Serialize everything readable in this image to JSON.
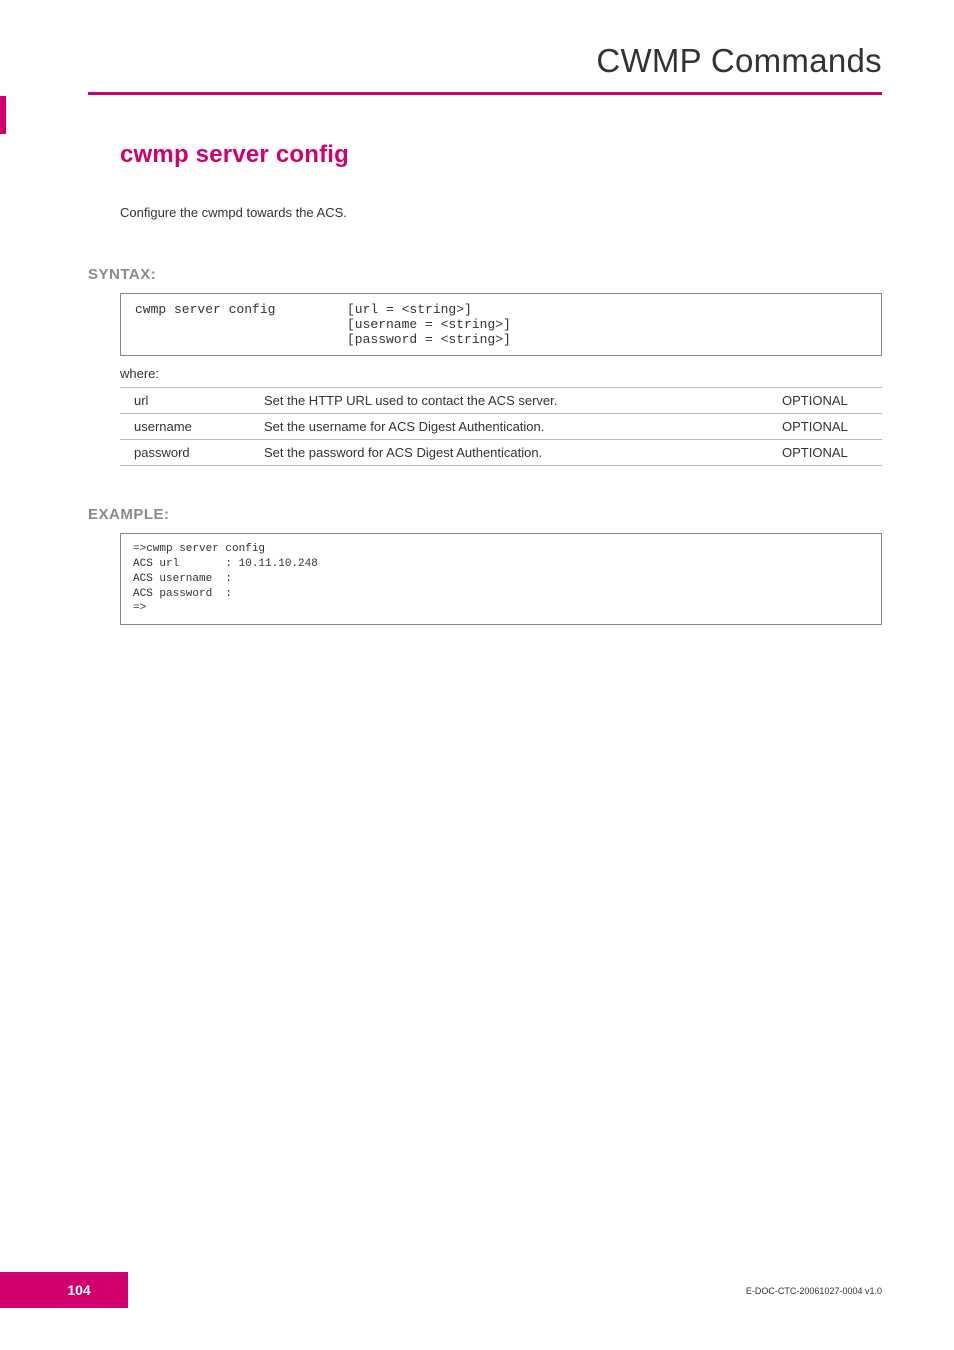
{
  "header": {
    "title": "CWMP Commands"
  },
  "sidetab": true,
  "cmd": {
    "title": "cwmp server config",
    "intro": "Configure the cwmpd towards the ACS."
  },
  "syntax": {
    "label": "SYNTAX:",
    "command": "cwmp server config",
    "args": "[url = <string>]\n[username = <string>]\n[password = <string>]",
    "where": "where:",
    "params": [
      {
        "name": "url",
        "desc": "Set the HTTP URL used to contact the ACS server.",
        "opt": "OPTIONAL"
      },
      {
        "name": "username",
        "desc": "Set the username for ACS Digest Authentication.",
        "opt": "OPTIONAL"
      },
      {
        "name": "password",
        "desc": "Set the password for ACS Digest Authentication.",
        "opt": "OPTIONAL"
      }
    ]
  },
  "example": {
    "label": "EXAMPLE:",
    "text": "=>cwmp server config\nACS url       : 10.11.10.248\nACS username  :\nACS password  :\n=>"
  },
  "footer": {
    "page": "104",
    "docid": "E-DOC-CTC-20061027-0004 v1.0"
  }
}
